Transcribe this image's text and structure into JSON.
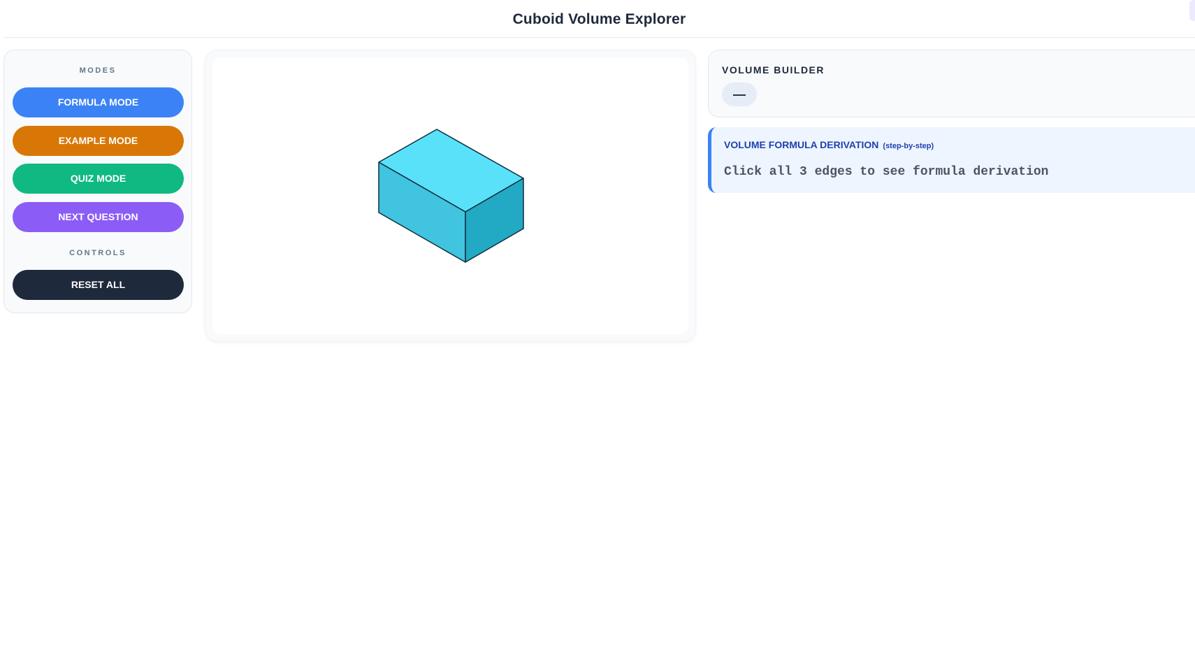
{
  "app": {
    "title": "Cuboid Volume Explorer"
  },
  "sidebar": {
    "modes_label": "MODES",
    "controls_label": "CONTROLS",
    "buttons": [
      {
        "id": "formula",
        "label": "FORMULA MODE",
        "color": "#3b82f6"
      },
      {
        "id": "example",
        "label": "EXAMPLE MODE",
        "color": "#d97706"
      },
      {
        "id": "quiz",
        "label": "QUIZ MODE",
        "color": "#10b981"
      },
      {
        "id": "next",
        "label": "NEXT QUESTION",
        "color": "#8b5cf6"
      }
    ],
    "reset": {
      "label": "RESET ALL",
      "color": "#1e293b"
    }
  },
  "cuboid": {
    "top_color": "#5ae1fa",
    "front_color": "#40c4df",
    "side_color": "#22a9c4",
    "edge_color": "#0f2d3d"
  },
  "volume_builder": {
    "title": "VOLUME BUILDER",
    "value": "—"
  },
  "derivation": {
    "title": "VOLUME FORMULA DERIVATION",
    "subtitle": "(step-by-step)",
    "message": "Click all 3 edges to see formula derivation",
    "accent": "#3b82f6"
  }
}
